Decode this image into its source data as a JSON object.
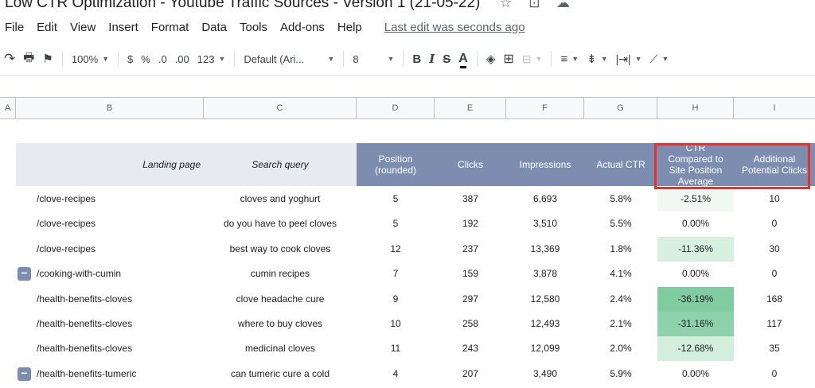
{
  "doc": {
    "title": "Low CTR Optimization - Youtube Traffic Sources - Version 1 (21-05-22)",
    "icons": [
      "star-icon",
      "move-to-folder-icon",
      "cloud-status-icon"
    ]
  },
  "menu": {
    "items": [
      "File",
      "Edit",
      "View",
      "Insert",
      "Format",
      "Data",
      "Tools",
      "Add-ons",
      "Help"
    ],
    "last_edit": "Last edit was seconds ago"
  },
  "toolbar": {
    "zoom": "100%",
    "currency": "$",
    "percent": "%",
    "decrease_decimal": ".0",
    "increase_decimal": ".00",
    "number_format": "123",
    "font": "Default (Ari...",
    "font_size": "8",
    "bold": "B",
    "italic": "I",
    "strike": "S",
    "text_color": "A"
  },
  "columns": [
    "A",
    "B",
    "C",
    "D",
    "E",
    "F",
    "G",
    "H",
    "I"
  ],
  "table": {
    "headers": {
      "landing": "Landing page",
      "query": "Search query",
      "position": "Position (rounded)",
      "clicks": "Clicks",
      "impressions": "Impressions",
      "ctr": "Actual CTR",
      "ctr_compared": "CTR Compared to Site Position Average",
      "additional": "Additional Potential Clicks"
    },
    "rows": [
      {
        "landing": "/clove-recipes",
        "query": "cloves and yoghurt",
        "position": "5",
        "clicks": "387",
        "impressions": "6,693",
        "ctr": "5.8%",
        "compared": "-2.51%",
        "additional": "10",
        "shade": "#f1f8f4",
        "group": false
      },
      {
        "landing": "/clove-recipes",
        "query": "do you have to peel cloves",
        "position": "5",
        "clicks": "192",
        "impressions": "3,510",
        "ctr": "5.5%",
        "compared": "0.00%",
        "additional": "0",
        "shade": "#ffffff",
        "group": false
      },
      {
        "landing": "/clove-recipes",
        "query": "best way to cook cloves",
        "position": "12",
        "clicks": "237",
        "impressions": "13,369",
        "ctr": "1.8%",
        "compared": "-11.36%",
        "additional": "30",
        "shade": "#d8f0e2",
        "group": false
      },
      {
        "landing": "/cooking-with-cumin",
        "query": "cumin recipes",
        "position": "7",
        "clicks": "159",
        "impressions": "3,878",
        "ctr": "4.1%",
        "compared": "0.00%",
        "additional": "0",
        "shade": "#ffffff",
        "group": true
      },
      {
        "landing": "/health-benefits-cloves",
        "query": "clove headache cure",
        "position": "9",
        "clicks": "297",
        "impressions": "12,580",
        "ctr": "2.4%",
        "compared": "-36.19%",
        "additional": "168",
        "shade": "#7fcca1",
        "group": false
      },
      {
        "landing": "/health-benefits-cloves",
        "query": "where to buy cloves",
        "position": "10",
        "clicks": "258",
        "impressions": "12,493",
        "ctr": "2.1%",
        "compared": "-31.16%",
        "additional": "117",
        "shade": "#8ed2ab",
        "group": false
      },
      {
        "landing": "/health-benefits-cloves",
        "query": "medicinal cloves",
        "position": "11",
        "clicks": "243",
        "impressions": "12,099",
        "ctr": "2.0%",
        "compared": "-12.68%",
        "additional": "35",
        "shade": "#d3eedd",
        "group": false
      },
      {
        "landing": "/health-benefits-tumeric",
        "query": "can tumeric cure a cold",
        "position": "4",
        "clicks": "207",
        "impressions": "3,490",
        "ctr": "5.9%",
        "compared": "0.00%",
        "additional": "0",
        "shade": "#ffffff",
        "group": true
      }
    ]
  },
  "colors": {
    "header_bg": "#7c8db0",
    "highlight_border": "#e8312a"
  }
}
